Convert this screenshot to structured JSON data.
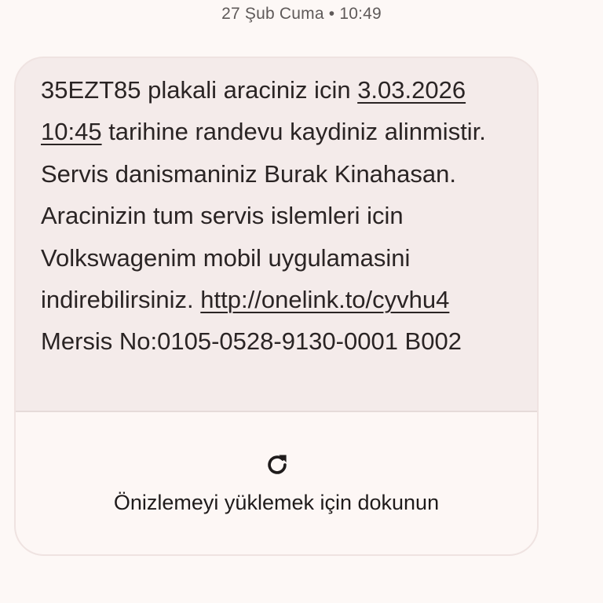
{
  "header": {
    "timestamp": "27 Şub Cuma • 10:49"
  },
  "message": {
    "part1": "35EZT85 plakali araciniz icin ",
    "date_link": "3.03.2026",
    "time_link": "10:45",
    "part2": " tarihine randevu kaydiniz alinmistir. Servis danismaniniz Burak Kinahasan. Aracinizin tum servis islemleri icin Volkswagenim mobil uygulamasini indirebilirsiniz. ",
    "url_link": "http://onelink.to/cyvhu4",
    "part3": " Mersis No:0105-0528-9130-0001 B002"
  },
  "preview": {
    "icon": "refresh-icon",
    "label": "Önizlemeyi yüklemek için dokunun"
  }
}
